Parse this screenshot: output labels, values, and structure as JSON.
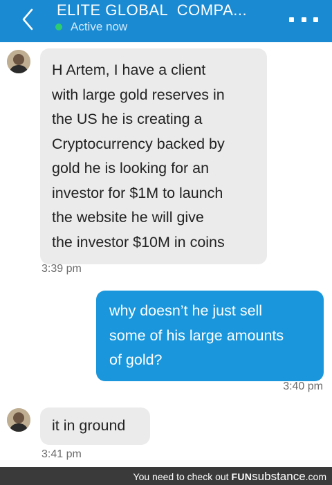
{
  "header": {
    "title": "ELITE GLOBAL  COMPA...",
    "status": "Active now",
    "back_icon": "chevron-left-icon",
    "more_icon": "more-horizontal-icon",
    "colors": {
      "bar": "#1a8ad3",
      "online": "#2ecc71"
    }
  },
  "messages": [
    {
      "direction": "incoming",
      "lines": [
        "H Artem, I have a client",
        "with large gold reserves in",
        "the US he is creating a",
        "Cryptocurrency backed by",
        "gold he is looking for an",
        "investor for $1M to launch",
        "the website he will give",
        "the investor $10M in coins"
      ],
      "time": "3:39 pm"
    },
    {
      "direction": "outgoing",
      "lines": [
        "why doesn’t he just sell",
        "some of his large amounts",
        "of gold?"
      ],
      "time": "3:40 pm"
    },
    {
      "direction": "incoming",
      "lines": [
        "it in ground"
      ],
      "time": "3:41 pm"
    }
  ],
  "footer": {
    "lead": "You need to check out",
    "brand_fun": "FUN",
    "brand_sub": "substance",
    "brand_tld": ".com"
  }
}
